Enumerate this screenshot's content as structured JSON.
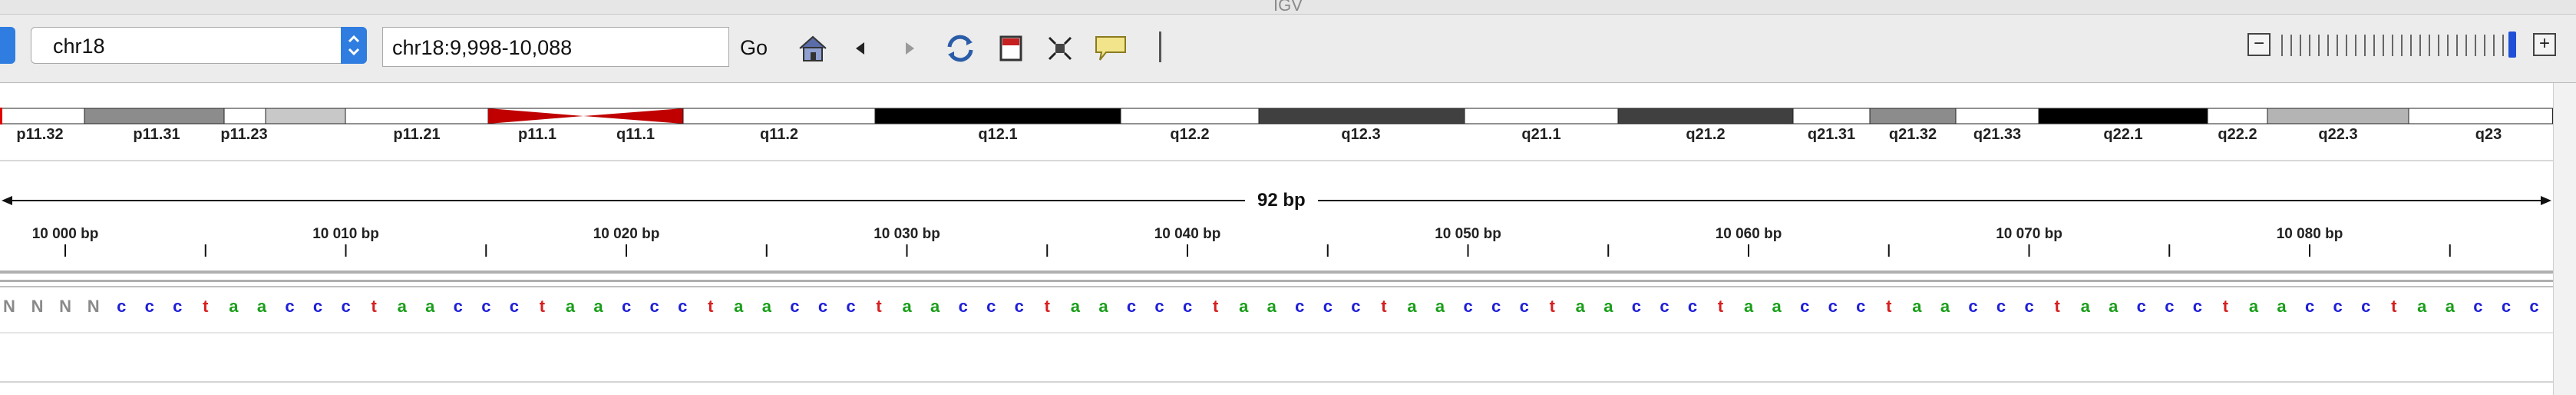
{
  "window": {
    "title": "IGV"
  },
  "toolbar": {
    "genome_value": "chr18",
    "locus_value": "chr18:9,998-10,088",
    "go_label": "Go",
    "icons": [
      "home-icon",
      "back-icon",
      "forward-icon",
      "refresh-icon",
      "roi-icon",
      "fit-icon",
      "popup-text-icon"
    ]
  },
  "ideogram": {
    "bands": [
      {
        "name": "p11.32",
        "color": "#ffffff",
        "start": 0,
        "end": 110
      },
      {
        "name": "p11.31",
        "color": "#8c8c8c",
        "start": 110,
        "end": 292
      },
      {
        "name": "p11.23",
        "color": "#ffffff",
        "start": 292,
        "end": 346
      },
      {
        "name": "",
        "color": "#c8c8c8",
        "start": 346,
        "end": 450
      },
      {
        "name": "p11.21",
        "color": "#ffffff",
        "start": 450,
        "end": 636
      },
      {
        "name": "p11.1",
        "color": "#c00000",
        "start": 636,
        "end": 760,
        "centromere": "p"
      },
      {
        "name": "q11.1",
        "color": "#c00000",
        "start": 760,
        "end": 890,
        "centromere": "q"
      },
      {
        "name": "q11.2",
        "color": "#ffffff",
        "start": 890,
        "end": 1140
      },
      {
        "name": "q12.1",
        "color": "#000000",
        "start": 1140,
        "end": 1460
      },
      {
        "name": "q12.2",
        "color": "#ffffff",
        "start": 1460,
        "end": 1640
      },
      {
        "name": "q12.3",
        "color": "#404040",
        "start": 1640,
        "end": 1908
      },
      {
        "name": "q21.1",
        "color": "#ffffff",
        "start": 1908,
        "end": 2108
      },
      {
        "name": "q21.2",
        "color": "#404040",
        "start": 2108,
        "end": 2336
      },
      {
        "name": "q21.31",
        "color": "#ffffff",
        "start": 2336,
        "end": 2436
      },
      {
        "name": "q21.32",
        "color": "#8c8c8c",
        "start": 2436,
        "end": 2548
      },
      {
        "name": "q21.33",
        "color": "#ffffff",
        "start": 2548,
        "end": 2656
      },
      {
        "name": "q22.1",
        "color": "#000000",
        "start": 2656,
        "end": 2876
      },
      {
        "name": "q22.2",
        "color": "#ffffff",
        "start": 2876,
        "end": 2954
      },
      {
        "name": "q22.3",
        "color": "#b4b4b4",
        "start": 2954,
        "end": 3138
      },
      {
        "name": "q23",
        "color": "#ffffff",
        "start": 3138,
        "end": 3326
      }
    ],
    "label_positions": [
      52,
      204,
      318,
      null,
      543,
      700,
      828,
      1015,
      1300,
      1550,
      1773,
      2008,
      2222,
      2386,
      2492,
      2602,
      2766,
      2915,
      3046,
      3242
    ]
  },
  "ruler": {
    "span_label": "92 bp",
    "labels": [
      "10 000 bp",
      "10 010 bp",
      "10 020 bp",
      "10 030 bp",
      "10 040 bp",
      "10 050 bp",
      "10 060 bp",
      "10 070 bp",
      "10 080 bp"
    ]
  },
  "sequence": {
    "bases": "NNNNccctaaccctaaccctaaccctaaccctaaccctaaccctaaccctaaccctaaccctaaccctaaccctaaccctaaccctaaccctaaccct",
    "colors": {
      "a": "#1a9e1a",
      "c": "#1f1fd6",
      "g": "#d18e00",
      "t": "#d61f1f",
      "N": "#8a8a8a"
    }
  }
}
